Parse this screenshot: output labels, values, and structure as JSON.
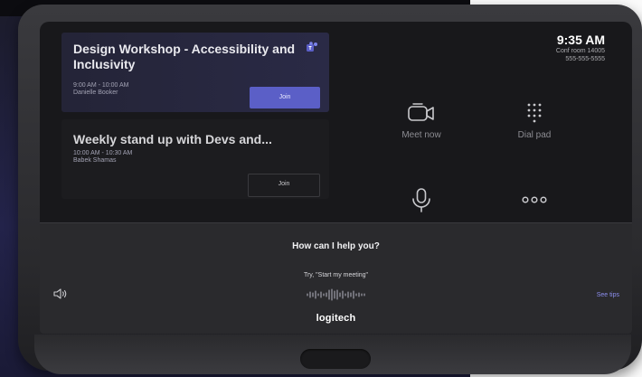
{
  "meetings": [
    {
      "title": "Design Workshop - Accessibility and Inclusivity",
      "time": "9:00 AM - 10:00 AM",
      "host": "Danielle Booker",
      "join_label": "Join"
    },
    {
      "title": "Weekly stand up with Devs and...",
      "time": "10:00 AM - 10:30 AM",
      "host": "Babek Shamas",
      "join_label": "Join"
    }
  ],
  "clock": {
    "time": "9:35 AM",
    "room": "Conf room 14005",
    "phone": "555-555-5555"
  },
  "actions": {
    "meet_now": "Meet now",
    "dial_pad": "Dial pad"
  },
  "voice": {
    "title": "How can I help you?",
    "hint": "Try, \"Start my meeting\"",
    "see_tips": "See tips"
  },
  "brand": "logitech",
  "colors": {
    "accent": "#5b5fc7",
    "tips_link": "#8c8eef",
    "screen_bg": "#18181b"
  },
  "icons": [
    "teams-icon",
    "video-camera-icon",
    "dial-pad-icon",
    "microphone-icon",
    "more-dots-icon",
    "speaker-icon",
    "waveform-icon"
  ]
}
